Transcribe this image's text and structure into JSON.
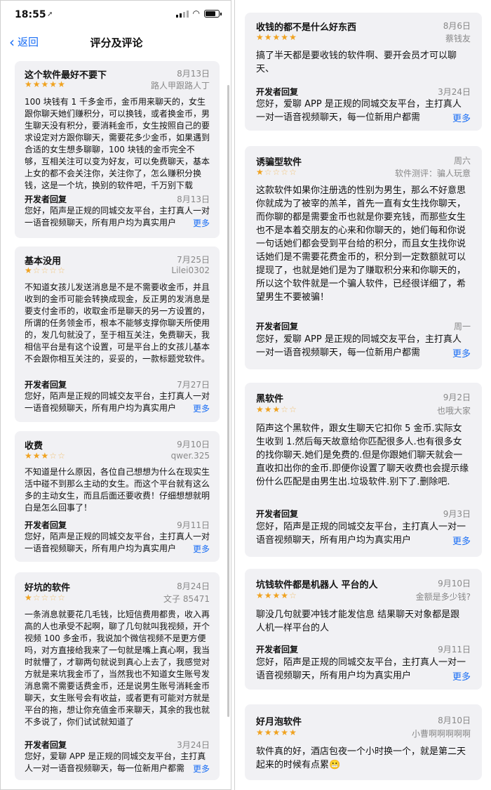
{
  "status": {
    "time": "18:55",
    "location_icon": "location-arrow-icon"
  },
  "nav": {
    "back_label": "返回",
    "title": "评分及评论"
  },
  "reviews_left": [
    {
      "title": "这个软件最好不要下",
      "date": "8月13日",
      "stars": 5,
      "user": "路人甲跟路人丁",
      "body": "100 块钱有 1 千多金币，金币用来聊天的，女生跟你聊天她们赚积分，可以换钱，或者换金币，男生聊天没有积分，要消耗金币，女生按照自己的要求设定对方跟你聊天，需要花多少金币，如果遇到合适的女生想多聊聊，100 块钱的金币完全不够，互相关注可以变为好友，可以免费聊天，基本上女的都不会关注你，关注你了，怎么赚积分换钱，这是一个坑，换别的软件吧，千万别下载",
      "dev_label": "开发者回复",
      "dev_date": "8月13日",
      "dev_text": "您好，陌声是正规的同城交友平台，主打真人一对一语音视频聊天，所有用户均为真实用户",
      "more": "更多"
    },
    {
      "title": "基本没用",
      "date": "7月25日",
      "stars": 1,
      "user": "Lilei0302",
      "body": "不知道女孩儿发送消息是不是不需要收金币，并且收到的金币可能会转换成现金，反正男的发消息是要支付金币的，收取金币是聊天的另一方设置的，所谓的任务领金币，根本不能够支撑你聊天所使用的，发几句就没了，至于相互关注，免费聊天，我相信平台是有这个设置，可是平台上的女孩儿基本不会跟你相互关注的，妥妥的，一款标题党软件。",
      "dev_label": "开发者回复",
      "dev_date": "7月27日",
      "dev_text": "您好，陌声是正规的同城交友平台，主打真人一对一语音视频聊天，所有用户均为真实用户",
      "more": "更多"
    },
    {
      "title": "收费",
      "date": "9月10日",
      "stars": 3,
      "user": "qwer.325",
      "body": "不知道是什么原因，各位自己想想为什么在现实生活中碰不到那么主动的女生。而这个平台就有这么多的主动女生，而且后面还要收费！仔细想想就明白是怎么回事了！",
      "dev_label": "开发者回复",
      "dev_date": "9月11日",
      "dev_text": "您好，陌声是正规的同城交友平台，主打真人一对一语音视频聊天，所有用户均为真实用户",
      "more": "更多"
    },
    {
      "title": "好坑的软件",
      "date": "8月24日",
      "stars": 1,
      "user": "文子 85471",
      "body": "一条消息就要花几毛钱，比短信费用都贵，收入再高的人也承受不起啊，聊了几句就叫我视频，开个视频 100 多金币，我说加个微信视频不是更方便吗，对方直接给我来了一句就是嘴上真心啊，我当时就懵了，才聊两句就说到真心上去了，我感觉对方就是来坑我金币了，当然我也不知道女生账号发消息需不需要话费金币，还是说男生账号消耗金币聊天，女生账号会有收益，或者更有可能对方就是平台的拖，想让你充值金币来聊天，其余的我也就不多说了，你们试试就知道了",
      "dev_label": "开发者回复",
      "dev_date": "3月24日",
      "dev_text": "您好，爱聊 APP 是正规的同城交友平台，主打真人一对一语音视频聊天，每一位新用户都需",
      "more": "更多"
    }
  ],
  "reviews_right": [
    {
      "title": "收钱的都不是什么好东西",
      "date": "8月6日",
      "stars": 5,
      "user": "蔡钱友",
      "body": "搞了半天都是要收钱的软件啊、要开会员才可以聊天、",
      "dev_label": "开发者回复",
      "dev_date": "3月24日",
      "dev_text": "您好，爱聊 APP 是正规的同城交友平台，主打真人一对一语音视频聊天，每一位新用户都需",
      "more": "更多"
    },
    {
      "title": "诱骗型软件",
      "date": "周六",
      "stars": 1,
      "user": "软件测评：骗人玩意",
      "body": "这款软件如果你注册选的性别为男生，那么不好意思你就成为了被宰的羔羊，首先一直有女生找你聊天，而你聊的都是需要金币也就是你要充钱，而那些女生也不是本着交朋友的心来和你聊天的，她们每和你说一句话她们都会受到平台给的积分，而且女生找你说话她们是不需要花费金币的，积分到一定数额就可以提现了，也就是她们是为了赚取积分来和你聊天的，所以这个软件就是一个骗人软件，已经很详细了，希望男生不要被骗！",
      "dev_label": "开发者回复",
      "dev_date": "周一",
      "dev_text": "您好，爱聊 APP 是正规的同城交友平台，主打真人一对一语音视频聊天，每一位新用户都需",
      "more": "更多"
    },
    {
      "title": "黑软件",
      "date": "9月2日",
      "stars": 3,
      "user": "也哦大家",
      "body": "陌声这个黑软件，跟女生聊天它扣你 5 金币.实际女生收到 1.然后每天故意给你匹配很多人.也有很多女的找你聊天.她们是免费的.但是你跟她们聊天就会一直收扣出你的金币.即便你设置了聊天收费也会提示缘份什么匹配是由男生出.垃圾软件.别下了.删除吧.",
      "dev_label": "开发者回复",
      "dev_date": "9月3日",
      "dev_text": "您好，陌声是正规的同城交友平台，主打真人一对一语音视频聊天，所有用户均为真实用户",
      "more": "更多"
    },
    {
      "title": "坑钱软件都是机器人 平台的人",
      "date": "9月10日",
      "stars": 4,
      "user": "金额是多少钱?",
      "body": "聊没几句就要冲钱才能发信息 结果聊天对象都是跟人机一样平台的人",
      "dev_label": "开发者回复",
      "dev_date": "9月11日",
      "dev_text": "您好，陌声是正规的同城交友平台，主打真人一对一语音视频聊天，所有用户均为真实用户",
      "more": "更多"
    },
    {
      "title": "好月泡软件",
      "date": "8月10日",
      "stars": 5,
      "user": "小曹啊啊啊啊啊",
      "body": "软件真的好，酒店包夜一个小时换一个，就是第二天起来的时候有点累😬"
    }
  ],
  "colors": {
    "accent": "#1a6ef5",
    "star": "#f0a21f",
    "card": "#f1f1f4"
  }
}
